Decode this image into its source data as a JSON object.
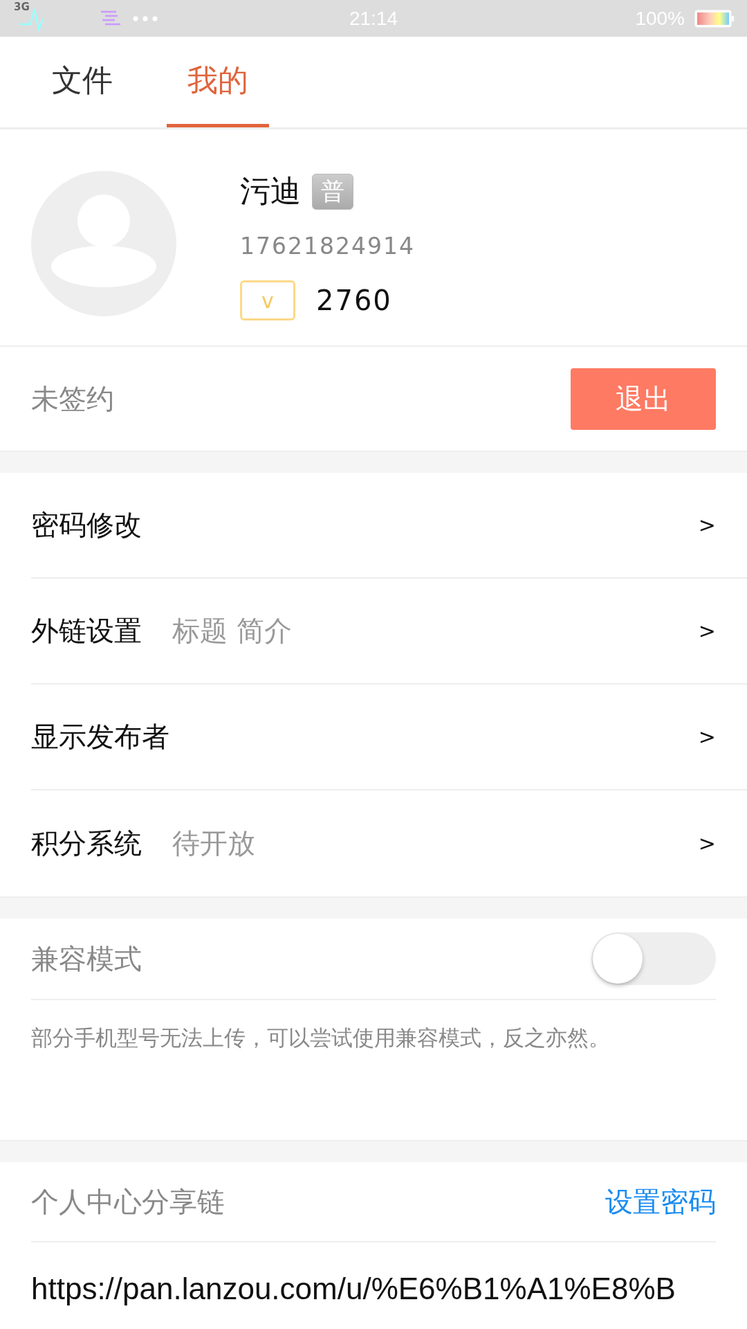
{
  "status_bar": {
    "network": "3G",
    "time": "21:14",
    "battery": "100%"
  },
  "tabs": [
    {
      "label": "文件",
      "selected": false
    },
    {
      "label": "我的",
      "selected": true
    }
  ],
  "profile": {
    "name": "污迪",
    "badge": "普",
    "phone": "17621824914",
    "vip_badge": "v",
    "points": "2760"
  },
  "contract": {
    "status": "未签约",
    "button": "退出"
  },
  "menu": [
    {
      "label": "密码修改",
      "arrow": ">"
    },
    {
      "label": "外链设置",
      "hint": "标题 简介",
      "arrow": ">"
    },
    {
      "label": "显示发布者",
      "arrow": ">"
    },
    {
      "label": "积分系统",
      "hint": "待开放",
      "arrow": ">"
    }
  ],
  "compat": {
    "label": "兼容模式",
    "on": false,
    "description": "部分手机型号无法上传，可以尝试使用兼容模式，反之亦然。"
  },
  "share": {
    "title": "个人中心分享链",
    "action": "设置密码",
    "url": "https://pan.lanzou.com/u/%E6%B1%A1%E8%B"
  }
}
